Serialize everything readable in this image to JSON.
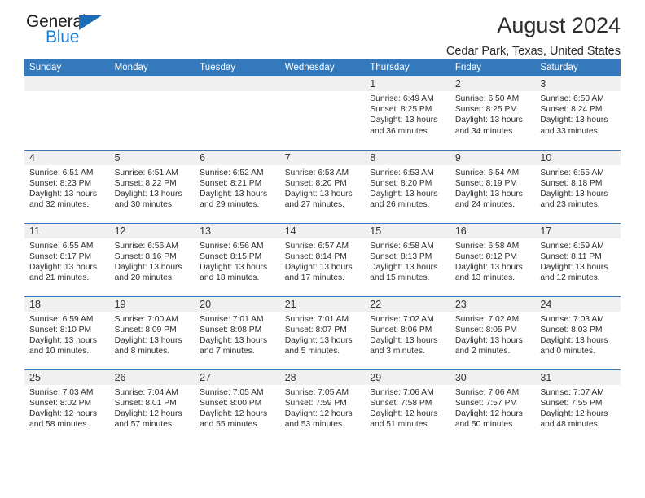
{
  "brand": {
    "name_top": "General",
    "name_bottom": "Blue",
    "accent_color": "#1c7fd4",
    "triangle_color": "#1c6cb5"
  },
  "header": {
    "title": "August 2024",
    "location": "Cedar Park, Texas, United States"
  },
  "theme": {
    "header_bg": "#3479bb",
    "daynum_bg": "#f0f0f0",
    "grid_line": "#3479bb",
    "text": "#2e2e2e"
  },
  "weekday_headers": [
    "Sunday",
    "Monday",
    "Tuesday",
    "Wednesday",
    "Thursday",
    "Friday",
    "Saturday"
  ],
  "labels": {
    "sunrise_prefix": "Sunrise: ",
    "sunset_prefix": "Sunset: ",
    "daylight_prefix": "Daylight: "
  },
  "weeks": [
    [
      {
        "day": "",
        "sunrise": "",
        "sunset": "",
        "daylight_line1": "",
        "daylight_line2": ""
      },
      {
        "day": "",
        "sunrise": "",
        "sunset": "",
        "daylight_line1": "",
        "daylight_line2": ""
      },
      {
        "day": "",
        "sunrise": "",
        "sunset": "",
        "daylight_line1": "",
        "daylight_line2": ""
      },
      {
        "day": "",
        "sunrise": "",
        "sunset": "",
        "daylight_line1": "",
        "daylight_line2": ""
      },
      {
        "day": "1",
        "sunrise": "Sunrise: 6:49 AM",
        "sunset": "Sunset: 8:25 PM",
        "daylight_line1": "Daylight: 13 hours",
        "daylight_line2": "and 36 minutes."
      },
      {
        "day": "2",
        "sunrise": "Sunrise: 6:50 AM",
        "sunset": "Sunset: 8:25 PM",
        "daylight_line1": "Daylight: 13 hours",
        "daylight_line2": "and 34 minutes."
      },
      {
        "day": "3",
        "sunrise": "Sunrise: 6:50 AM",
        "sunset": "Sunset: 8:24 PM",
        "daylight_line1": "Daylight: 13 hours",
        "daylight_line2": "and 33 minutes."
      }
    ],
    [
      {
        "day": "4",
        "sunrise": "Sunrise: 6:51 AM",
        "sunset": "Sunset: 8:23 PM",
        "daylight_line1": "Daylight: 13 hours",
        "daylight_line2": "and 32 minutes."
      },
      {
        "day": "5",
        "sunrise": "Sunrise: 6:51 AM",
        "sunset": "Sunset: 8:22 PM",
        "daylight_line1": "Daylight: 13 hours",
        "daylight_line2": "and 30 minutes."
      },
      {
        "day": "6",
        "sunrise": "Sunrise: 6:52 AM",
        "sunset": "Sunset: 8:21 PM",
        "daylight_line1": "Daylight: 13 hours",
        "daylight_line2": "and 29 minutes."
      },
      {
        "day": "7",
        "sunrise": "Sunrise: 6:53 AM",
        "sunset": "Sunset: 8:20 PM",
        "daylight_line1": "Daylight: 13 hours",
        "daylight_line2": "and 27 minutes."
      },
      {
        "day": "8",
        "sunrise": "Sunrise: 6:53 AM",
        "sunset": "Sunset: 8:20 PM",
        "daylight_line1": "Daylight: 13 hours",
        "daylight_line2": "and 26 minutes."
      },
      {
        "day": "9",
        "sunrise": "Sunrise: 6:54 AM",
        "sunset": "Sunset: 8:19 PM",
        "daylight_line1": "Daylight: 13 hours",
        "daylight_line2": "and 24 minutes."
      },
      {
        "day": "10",
        "sunrise": "Sunrise: 6:55 AM",
        "sunset": "Sunset: 8:18 PM",
        "daylight_line1": "Daylight: 13 hours",
        "daylight_line2": "and 23 minutes."
      }
    ],
    [
      {
        "day": "11",
        "sunrise": "Sunrise: 6:55 AM",
        "sunset": "Sunset: 8:17 PM",
        "daylight_line1": "Daylight: 13 hours",
        "daylight_line2": "and 21 minutes."
      },
      {
        "day": "12",
        "sunrise": "Sunrise: 6:56 AM",
        "sunset": "Sunset: 8:16 PM",
        "daylight_line1": "Daylight: 13 hours",
        "daylight_line2": "and 20 minutes."
      },
      {
        "day": "13",
        "sunrise": "Sunrise: 6:56 AM",
        "sunset": "Sunset: 8:15 PM",
        "daylight_line1": "Daylight: 13 hours",
        "daylight_line2": "and 18 minutes."
      },
      {
        "day": "14",
        "sunrise": "Sunrise: 6:57 AM",
        "sunset": "Sunset: 8:14 PM",
        "daylight_line1": "Daylight: 13 hours",
        "daylight_line2": "and 17 minutes."
      },
      {
        "day": "15",
        "sunrise": "Sunrise: 6:58 AM",
        "sunset": "Sunset: 8:13 PM",
        "daylight_line1": "Daylight: 13 hours",
        "daylight_line2": "and 15 minutes."
      },
      {
        "day": "16",
        "sunrise": "Sunrise: 6:58 AM",
        "sunset": "Sunset: 8:12 PM",
        "daylight_line1": "Daylight: 13 hours",
        "daylight_line2": "and 13 minutes."
      },
      {
        "day": "17",
        "sunrise": "Sunrise: 6:59 AM",
        "sunset": "Sunset: 8:11 PM",
        "daylight_line1": "Daylight: 13 hours",
        "daylight_line2": "and 12 minutes."
      }
    ],
    [
      {
        "day": "18",
        "sunrise": "Sunrise: 6:59 AM",
        "sunset": "Sunset: 8:10 PM",
        "daylight_line1": "Daylight: 13 hours",
        "daylight_line2": "and 10 minutes."
      },
      {
        "day": "19",
        "sunrise": "Sunrise: 7:00 AM",
        "sunset": "Sunset: 8:09 PM",
        "daylight_line1": "Daylight: 13 hours",
        "daylight_line2": "and 8 minutes."
      },
      {
        "day": "20",
        "sunrise": "Sunrise: 7:01 AM",
        "sunset": "Sunset: 8:08 PM",
        "daylight_line1": "Daylight: 13 hours",
        "daylight_line2": "and 7 minutes."
      },
      {
        "day": "21",
        "sunrise": "Sunrise: 7:01 AM",
        "sunset": "Sunset: 8:07 PM",
        "daylight_line1": "Daylight: 13 hours",
        "daylight_line2": "and 5 minutes."
      },
      {
        "day": "22",
        "sunrise": "Sunrise: 7:02 AM",
        "sunset": "Sunset: 8:06 PM",
        "daylight_line1": "Daylight: 13 hours",
        "daylight_line2": "and 3 minutes."
      },
      {
        "day": "23",
        "sunrise": "Sunrise: 7:02 AM",
        "sunset": "Sunset: 8:05 PM",
        "daylight_line1": "Daylight: 13 hours",
        "daylight_line2": "and 2 minutes."
      },
      {
        "day": "24",
        "sunrise": "Sunrise: 7:03 AM",
        "sunset": "Sunset: 8:03 PM",
        "daylight_line1": "Daylight: 13 hours",
        "daylight_line2": "and 0 minutes."
      }
    ],
    [
      {
        "day": "25",
        "sunrise": "Sunrise: 7:03 AM",
        "sunset": "Sunset: 8:02 PM",
        "daylight_line1": "Daylight: 12 hours",
        "daylight_line2": "and 58 minutes."
      },
      {
        "day": "26",
        "sunrise": "Sunrise: 7:04 AM",
        "sunset": "Sunset: 8:01 PM",
        "daylight_line1": "Daylight: 12 hours",
        "daylight_line2": "and 57 minutes."
      },
      {
        "day": "27",
        "sunrise": "Sunrise: 7:05 AM",
        "sunset": "Sunset: 8:00 PM",
        "daylight_line1": "Daylight: 12 hours",
        "daylight_line2": "and 55 minutes."
      },
      {
        "day": "28",
        "sunrise": "Sunrise: 7:05 AM",
        "sunset": "Sunset: 7:59 PM",
        "daylight_line1": "Daylight: 12 hours",
        "daylight_line2": "and 53 minutes."
      },
      {
        "day": "29",
        "sunrise": "Sunrise: 7:06 AM",
        "sunset": "Sunset: 7:58 PM",
        "daylight_line1": "Daylight: 12 hours",
        "daylight_line2": "and 51 minutes."
      },
      {
        "day": "30",
        "sunrise": "Sunrise: 7:06 AM",
        "sunset": "Sunset: 7:57 PM",
        "daylight_line1": "Daylight: 12 hours",
        "daylight_line2": "and 50 minutes."
      },
      {
        "day": "31",
        "sunrise": "Sunrise: 7:07 AM",
        "sunset": "Sunset: 7:55 PM",
        "daylight_line1": "Daylight: 12 hours",
        "daylight_line2": "and 48 minutes."
      }
    ]
  ]
}
